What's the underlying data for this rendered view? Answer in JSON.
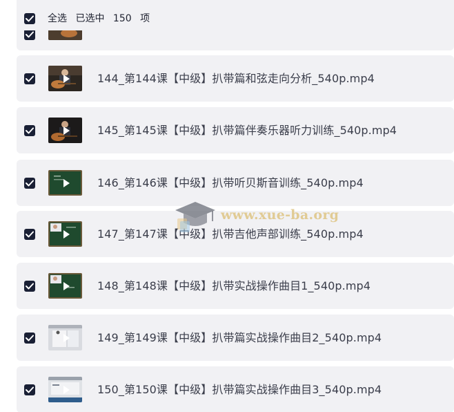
{
  "header": {
    "select_all_label": "全选",
    "selected_label": "已选中",
    "selected_count": "150",
    "unit_label": "项"
  },
  "files": [
    {
      "name": "",
      "thumb": "guitar"
    },
    {
      "name": "144_第144课【中级】扒带篇和弦走向分析_540p.mp4",
      "thumb": "guitar"
    },
    {
      "name": "145_第145课【中级】扒带篇伴奏乐器听力训练_540p.mp4",
      "thumb": "guitar-dark"
    },
    {
      "name": "146_第146课【中级】扒带听贝斯音训练_540p.mp4",
      "thumb": "board"
    },
    {
      "name": "147_第147课【中级】扒带吉他声部训练_540p.mp4",
      "thumb": "board-person"
    },
    {
      "name": "148_第148课【中级】扒带实战操作曲目1_540p.mp4",
      "thumb": "board-person"
    },
    {
      "name": "149_第149课【中级】扒带篇实战操作曲目2_540p.mp4",
      "thumb": "screen"
    },
    {
      "name": "150_第150课【中级】扒带篇实战操作曲目3_540p.mp4",
      "thumb": "screen-blue"
    }
  ],
  "watermark": {
    "text": "www.xue-ba.org"
  },
  "colors": {
    "row_bg": "#f1f1f4",
    "checkbox": "#1a2035",
    "text": "#3a3d4a",
    "watermark": "#dec482"
  }
}
